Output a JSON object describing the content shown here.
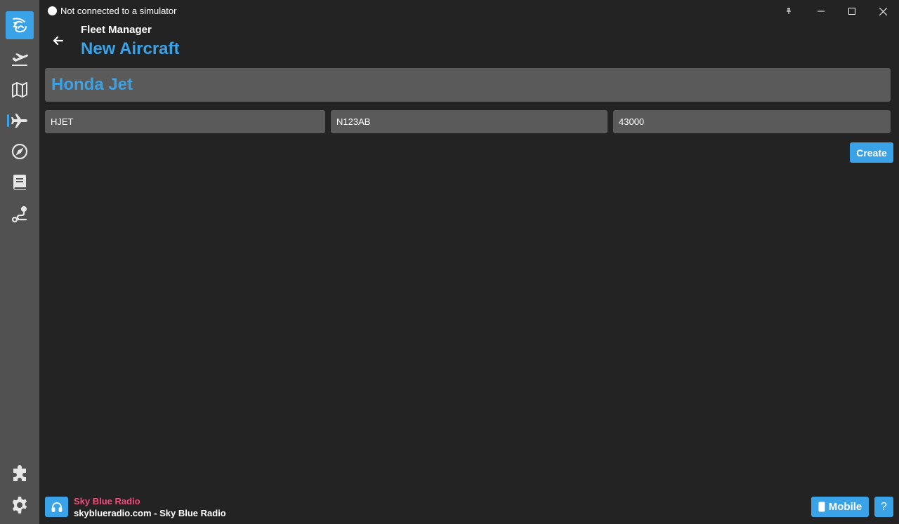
{
  "titlebar": {
    "status_text": "Not connected to a simulator",
    "status_indicator_color": "#ffffff"
  },
  "window_controls": [
    "pin-icon",
    "minimize-icon",
    "maximize-icon",
    "close-icon"
  ],
  "sidebar": {
    "items": [
      {
        "icon": "app-logo-icon",
        "active": false
      },
      {
        "icon": "flight-departure-icon",
        "active": false
      },
      {
        "icon": "map-icon",
        "active": false
      },
      {
        "icon": "airplane-icon",
        "active": true
      },
      {
        "icon": "compass-icon",
        "active": false
      },
      {
        "icon": "logbook-icon",
        "active": false
      },
      {
        "icon": "route-icon",
        "active": false
      },
      {
        "icon": "puzzle-icon",
        "active": false
      },
      {
        "icon": "gear-icon",
        "active": false
      }
    ]
  },
  "header": {
    "subtitle": "Fleet Manager",
    "title": "New Aircraft"
  },
  "form": {
    "name_value": "Honda Jet",
    "type_value": "HJET",
    "registration_value": "N123AB",
    "ceiling_value": "43000",
    "create_label": "Create"
  },
  "footer": {
    "radio_name": "Sky Blue Radio",
    "radio_url": "skyblueradio.com",
    "radio_separator": " - ",
    "radio_station": "Sky Blue Radio",
    "mobile_label": "Mobile",
    "help_label": "?"
  },
  "colors": {
    "accent": "#3aa2e6",
    "radio_accent": "#ec4e7c",
    "sidebar_bg": "#515151",
    "main_bg": "#232323",
    "input_bg": "#5a5a5a"
  }
}
